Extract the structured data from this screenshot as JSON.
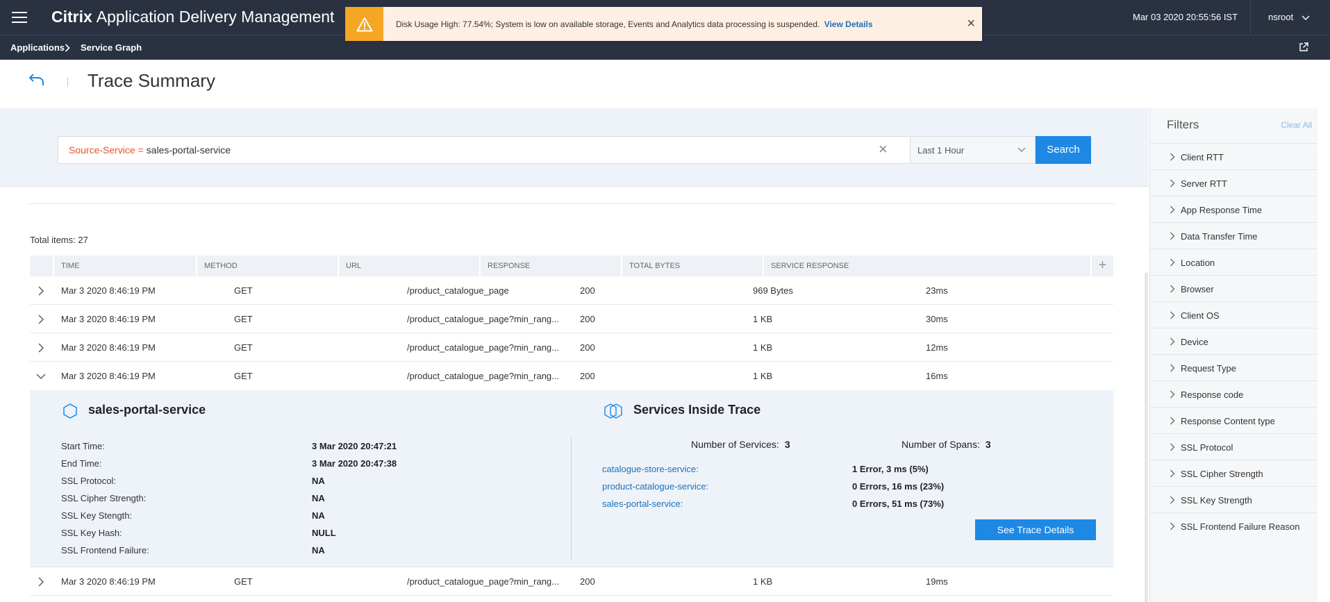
{
  "header": {
    "brand_bold": "Citrix",
    "brand_rest": "Application Delivery Management",
    "datetime": "Mar 03 2020 20:55:56 IST",
    "user": "nsroot"
  },
  "alert": {
    "text": "Disk Usage High: 77.54%; System is low on available storage, Events and Analytics data processing is suspended.",
    "link": "View Details",
    "close": "×"
  },
  "breadcrumb": {
    "items": [
      "Applications",
      "Service Graph"
    ]
  },
  "page": {
    "title": "Trace Summary"
  },
  "search": {
    "query_key": "Source-Service = ",
    "query_value": "sales-portal-service",
    "clear": "×",
    "range": "Last 1 Hour",
    "button": "Search"
  },
  "table": {
    "total": "Total items: 27",
    "columns": [
      "TIME",
      "METHOD",
      "URL",
      "RESPONSE",
      "TOTAL BYTES",
      "SERVICE RESPONSE"
    ],
    "add_column": "+",
    "rows": [
      {
        "time": "Mar 3 2020 8:46:19 PM",
        "method": "GET",
        "url": "/product_catalogue_page",
        "response": "200",
        "bytes": "969 Bytes",
        "service_response": "23ms"
      },
      {
        "time": "Mar 3 2020 8:46:19 PM",
        "method": "GET",
        "url": "/product_catalogue_page?min_rang...",
        "response": "200",
        "bytes": "1 KB",
        "service_response": "30ms"
      },
      {
        "time": "Mar 3 2020 8:46:19 PM",
        "method": "GET",
        "url": "/product_catalogue_page?min_rang...",
        "response": "200",
        "bytes": "1 KB",
        "service_response": "12ms"
      },
      {
        "time": "Mar 3 2020 8:46:19 PM",
        "method": "GET",
        "url": "/product_catalogue_page?min_rang...",
        "response": "200",
        "bytes": "1 KB",
        "service_response": "16ms"
      },
      {
        "time": "Mar 3 2020 8:46:19 PM",
        "method": "GET",
        "url": "/product_catalogue_page?min_rang...",
        "response": "200",
        "bytes": "1 KB",
        "service_response": "19ms"
      }
    ]
  },
  "detail": {
    "service_name": "sales-portal-service",
    "fields": [
      {
        "label": "Start Time:",
        "value": "3 Mar 2020 20:47:21"
      },
      {
        "label": "End Time:",
        "value": "3 Mar 2020 20:47:38"
      },
      {
        "label": "SSL Protocol:",
        "value": "NA"
      },
      {
        "label": "SSL Cipher Strength:",
        "value": "NA"
      },
      {
        "label": "SSL Key Stength:",
        "value": "NA"
      },
      {
        "label": "SSL Key Hash:",
        "value": "NULL"
      },
      {
        "label": "SSL Frontend Failure:",
        "value": "NA"
      }
    ],
    "services_title": "Services Inside Trace",
    "num_services_label": "Number of Services:",
    "num_services": "3",
    "num_spans_label": "Number of Spans:",
    "num_spans": "3",
    "services": [
      {
        "name": "catalogue-store-service:",
        "value": "1 Error, 3 ms (5%)"
      },
      {
        "name": "product-catalogue-service:",
        "value": "0 Errors, 16 ms (23%)"
      },
      {
        "name": "sales-portal-service:",
        "value": "0 Errors, 51 ms (73%)"
      }
    ],
    "trace_button": "See Trace Details"
  },
  "filters": {
    "title": "Filters",
    "clear": "Clear All",
    "items": [
      "Client RTT",
      "Server RTT",
      "App Response Time",
      "Data Transfer Time",
      "Location",
      "Browser",
      "Client OS",
      "Device",
      "Request Type",
      "Response code",
      "Response Content type",
      "SSL Protocol",
      "SSL Cipher Strength",
      "SSL Key Strength",
      "SSL Frontend Failure Reason"
    ]
  },
  "colors": {
    "topbar": "#2a3242",
    "accent": "#1e88e5",
    "alert_icon": "#f5a623",
    "query_key": "#e3552b",
    "link": "#1d6fb8"
  }
}
